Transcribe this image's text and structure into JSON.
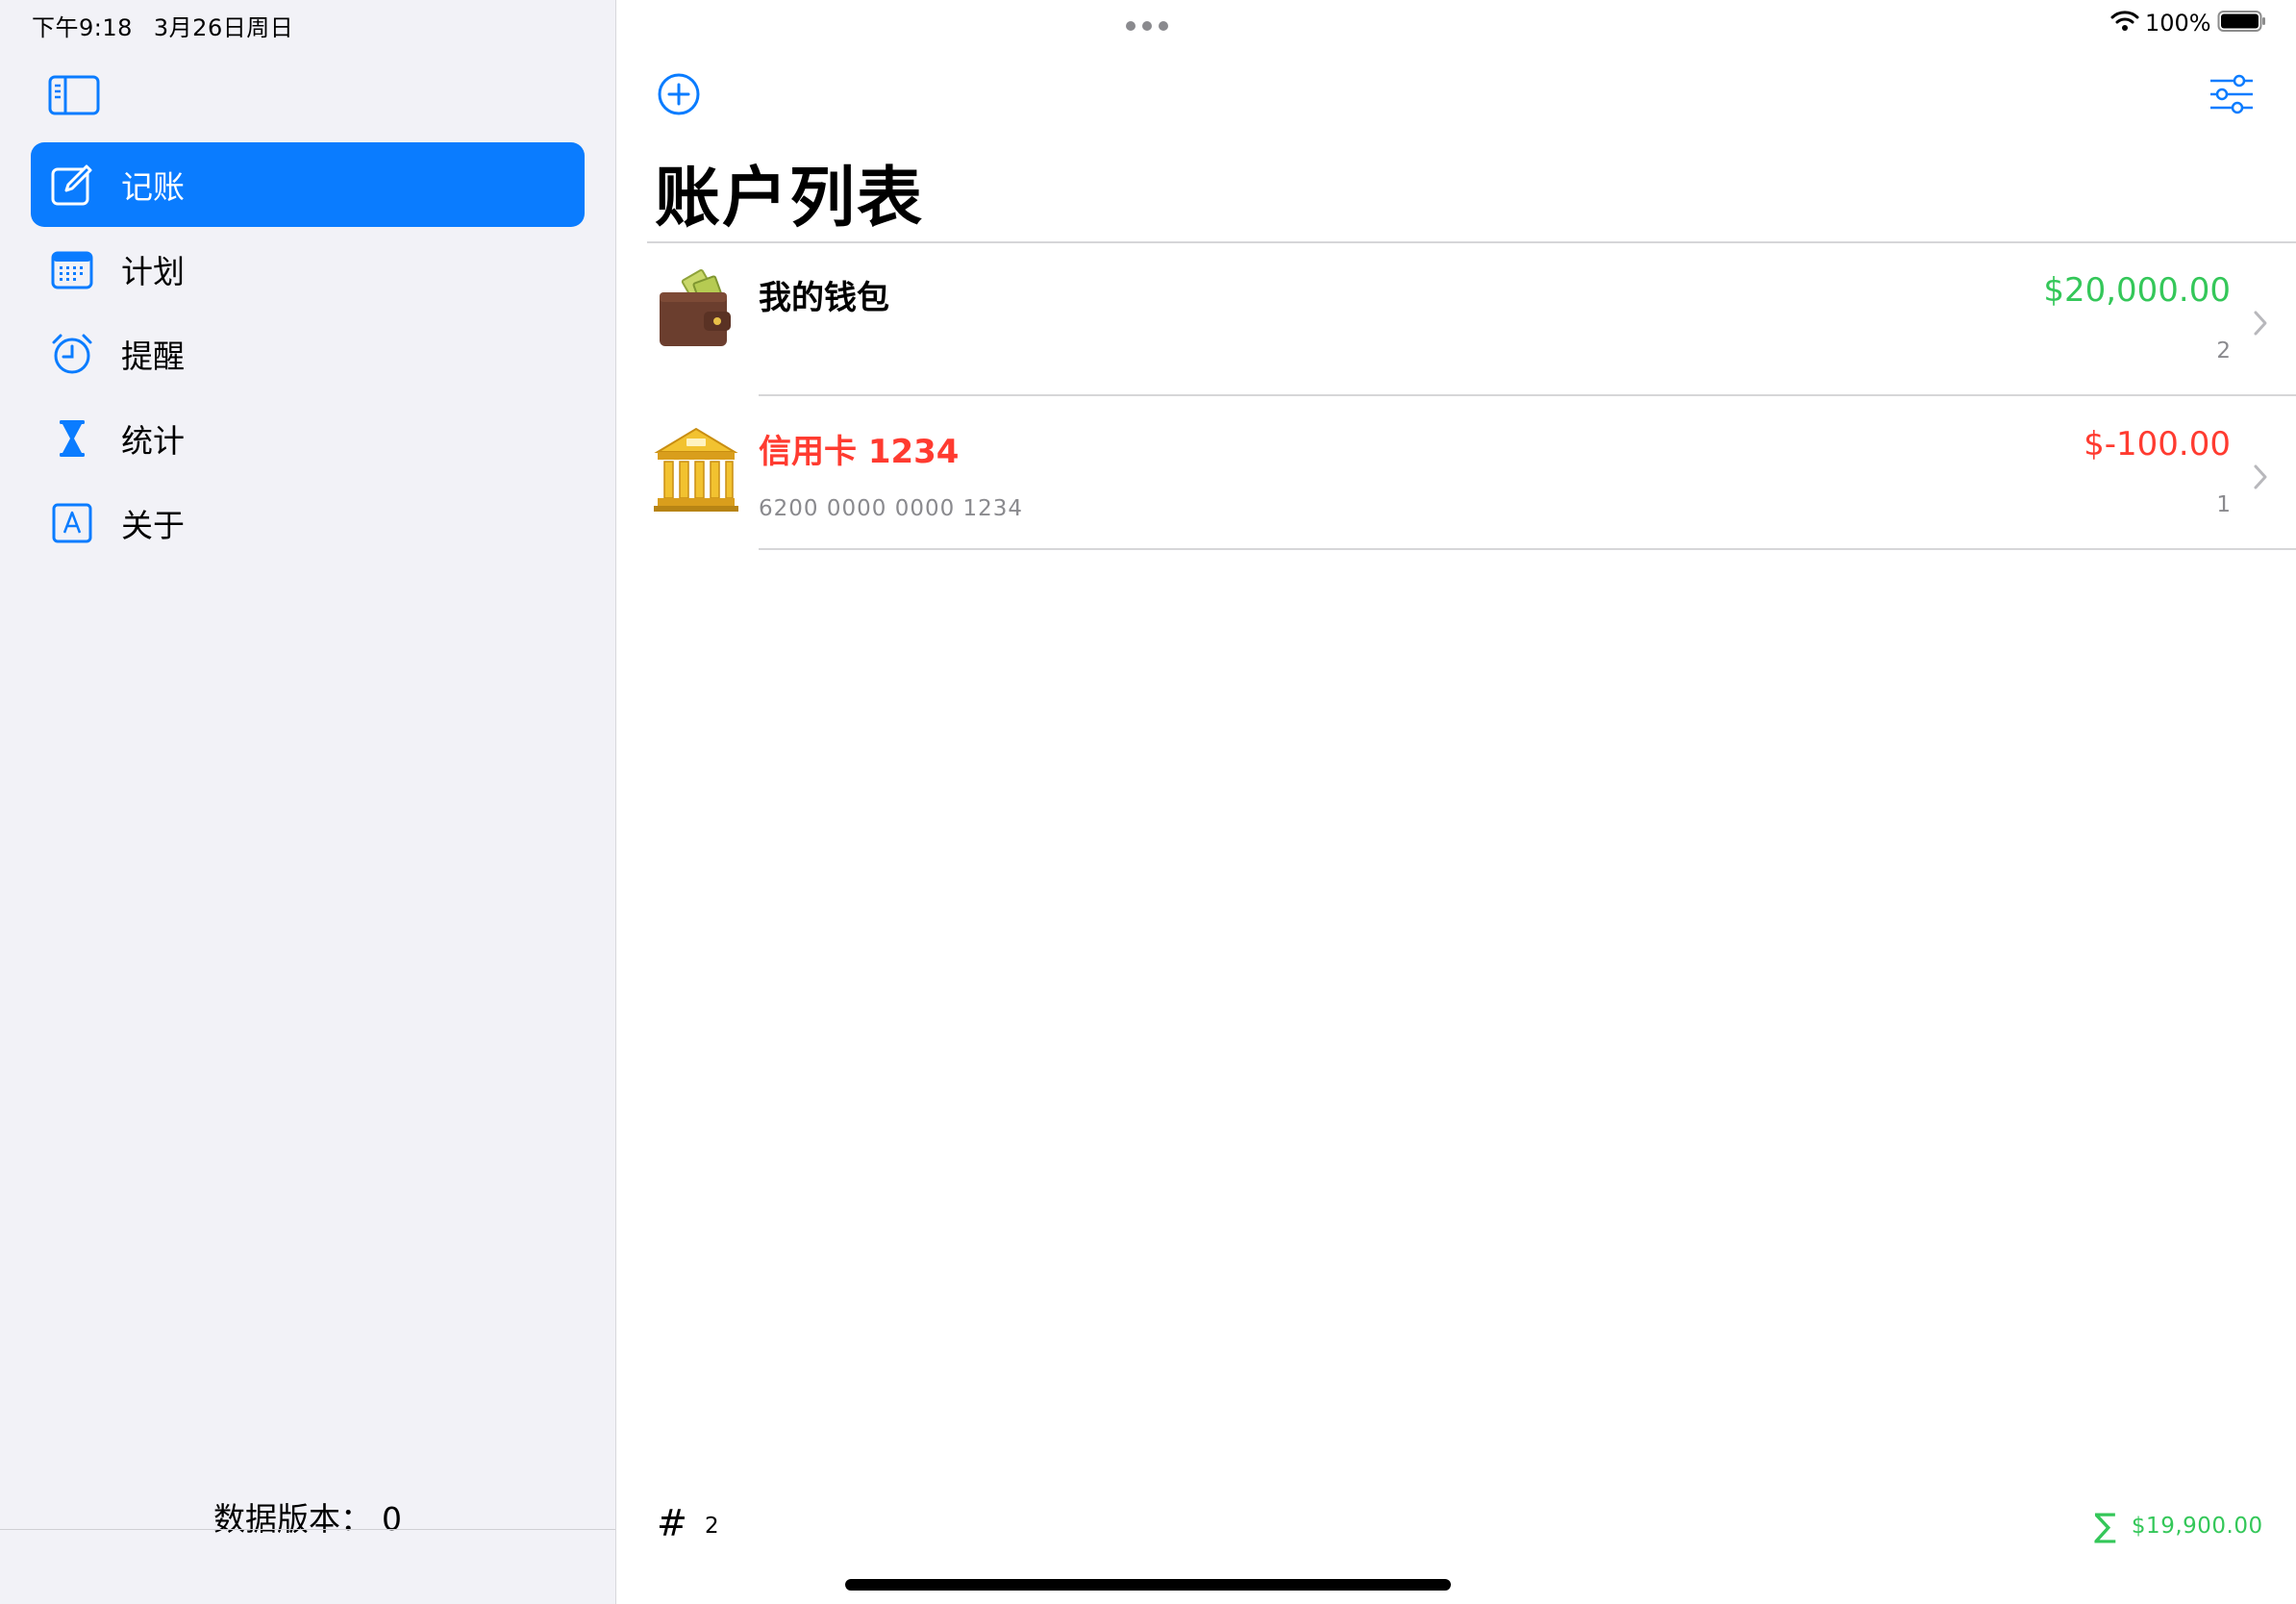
{
  "status_bar": {
    "time": "下午9:18",
    "date": "3月26日周日",
    "battery": "100%"
  },
  "colors": {
    "accent": "#0a7cff",
    "positive": "#34c759",
    "negative": "#ff3b30",
    "sidebar_bg": "#f2f2f7"
  },
  "sidebar": {
    "items": [
      {
        "label": "记账",
        "icon": "square-pencil-icon",
        "active": true
      },
      {
        "label": "计划",
        "icon": "calendar-icon",
        "active": false
      },
      {
        "label": "提醒",
        "icon": "alarm-clock-icon",
        "active": false
      },
      {
        "label": "统计",
        "icon": "hourglass-icon",
        "active": false
      },
      {
        "label": "关于",
        "icon": "app-store-a-icon",
        "active": false
      }
    ],
    "data_version_label": "数据版本：",
    "data_version_value": "0"
  },
  "main": {
    "title": "账户列表",
    "accounts": [
      {
        "name": "我的钱包",
        "icon": "wallet-icon",
        "sub": "",
        "amount": "$20,000.00",
        "count": "2",
        "tone": "positive"
      },
      {
        "name": "信用卡 1234",
        "icon": "bank-icon",
        "sub": "6200 0000 0000 1234",
        "amount": "$-100.00",
        "count": "1",
        "tone": "negative"
      }
    ],
    "footer": {
      "hash": "#",
      "count": "2",
      "sigma": "∑",
      "total": "$19,900.00"
    }
  }
}
